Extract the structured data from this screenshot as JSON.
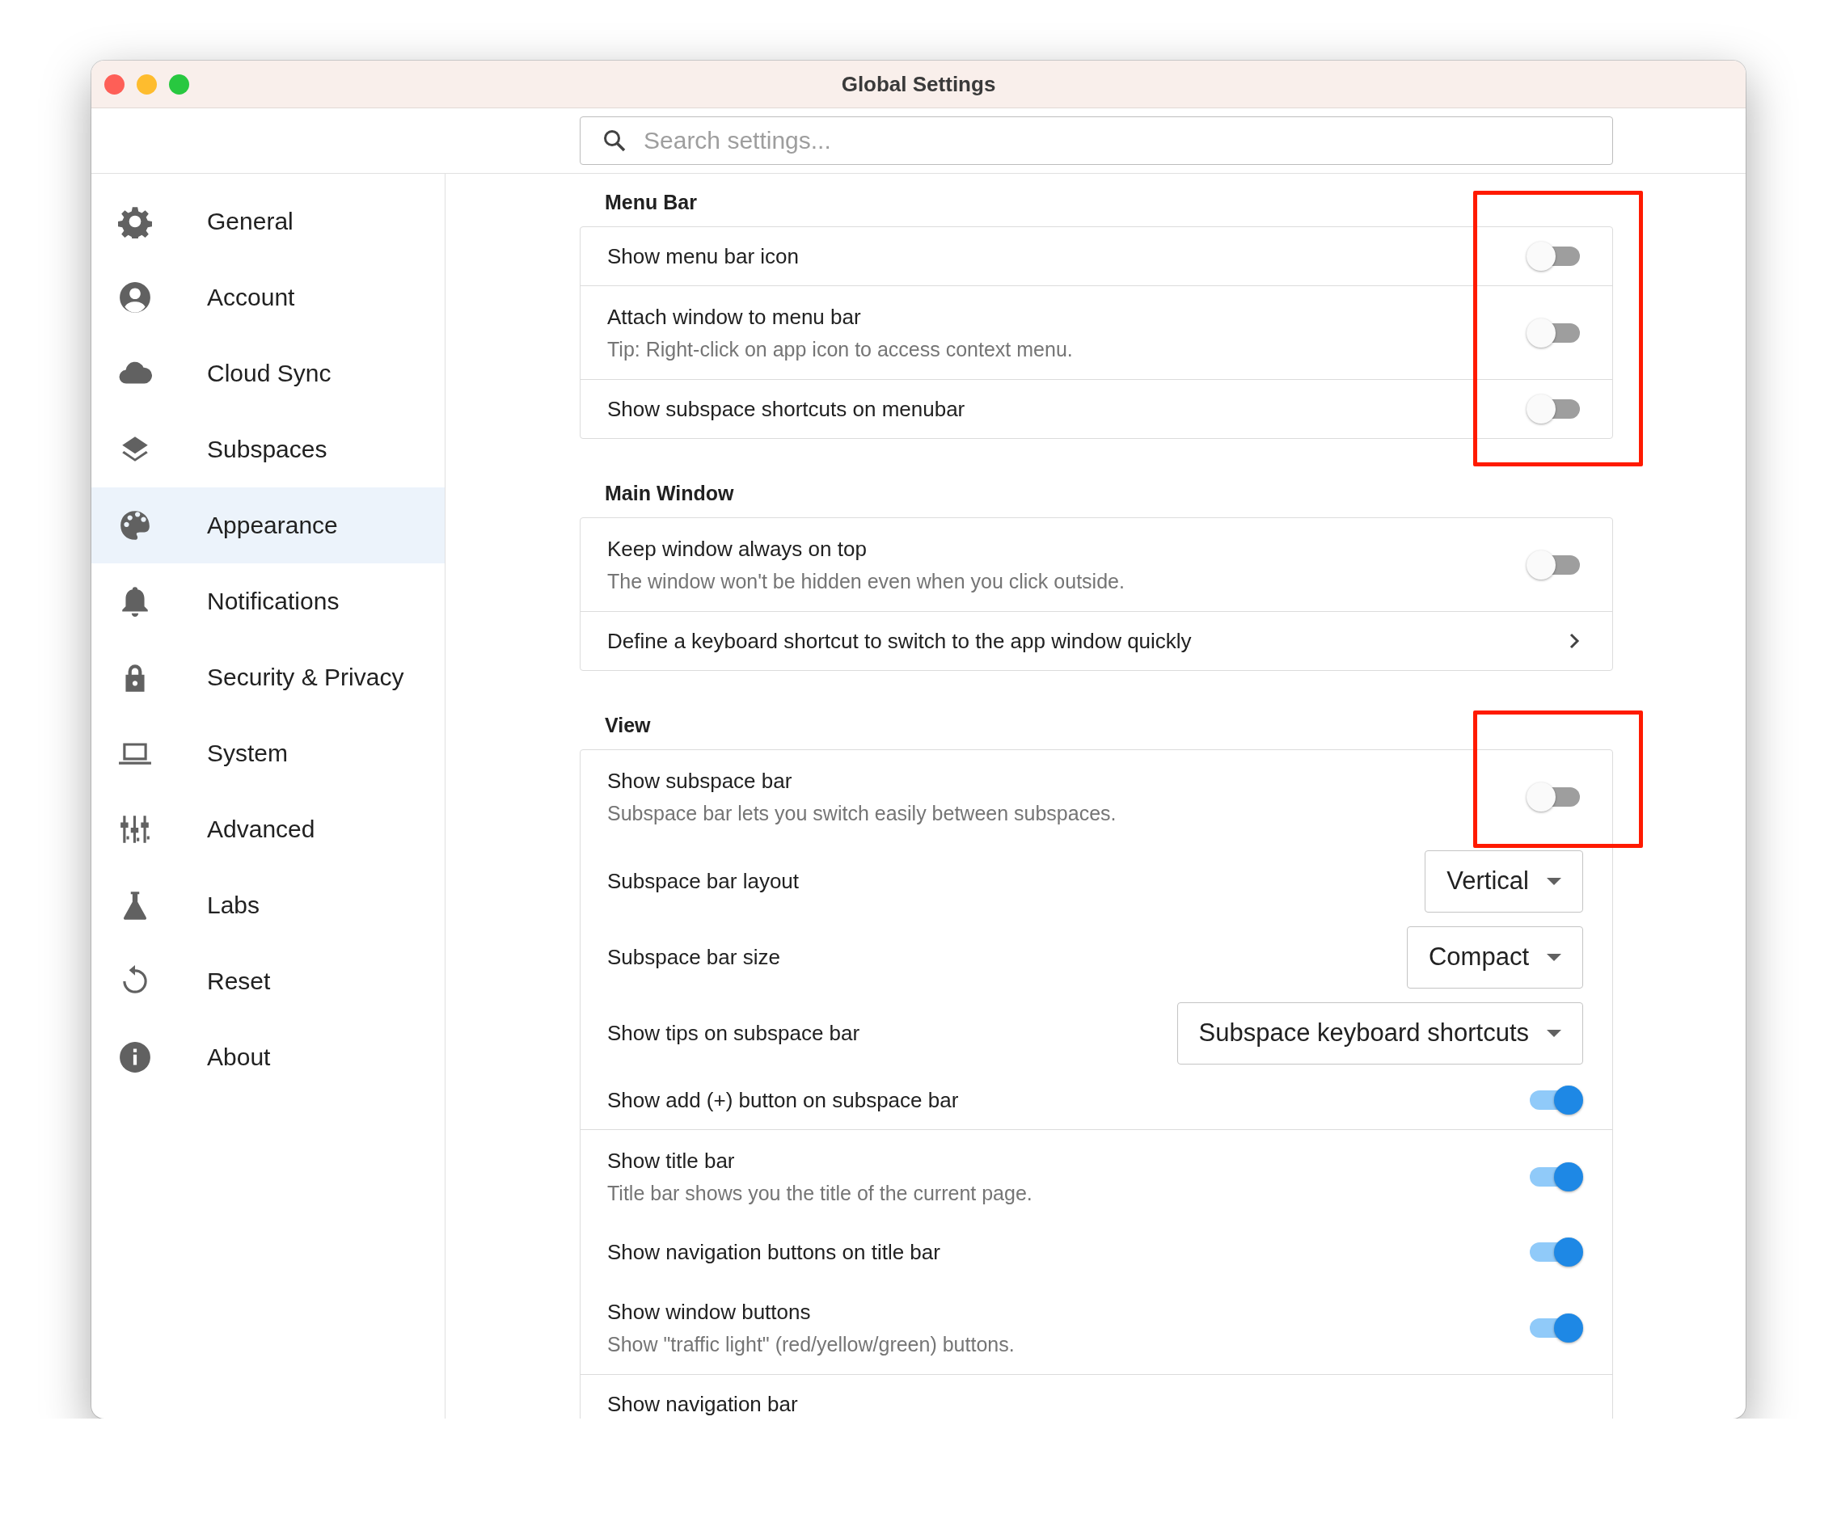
{
  "window": {
    "title": "Global Settings"
  },
  "search": {
    "placeholder": "Search settings..."
  },
  "sidebar": {
    "items": [
      {
        "label": "General",
        "selected": false
      },
      {
        "label": "Account",
        "selected": false
      },
      {
        "label": "Cloud Sync",
        "selected": false
      },
      {
        "label": "Subspaces",
        "selected": false
      },
      {
        "label": "Appearance",
        "selected": true
      },
      {
        "label": "Notifications",
        "selected": false
      },
      {
        "label": "Security & Privacy",
        "selected": false
      },
      {
        "label": "System",
        "selected": false
      },
      {
        "label": "Advanced",
        "selected": false
      },
      {
        "label": "Labs",
        "selected": false
      },
      {
        "label": "Reset",
        "selected": false
      },
      {
        "label": "About",
        "selected": false
      }
    ]
  },
  "sections": [
    {
      "title": "Menu Bar",
      "groups": [
        [
          {
            "kind": "toggle",
            "label": "Show menu bar icon",
            "on": false,
            "annotated": true
          }
        ],
        [
          {
            "kind": "toggle",
            "label": "Attach window to menu bar",
            "description": "Tip: Right-click on app icon to access context menu.",
            "on": false,
            "annotated": true
          }
        ],
        [
          {
            "kind": "toggle",
            "label": "Show subspace shortcuts on menubar",
            "on": false,
            "annotated": true
          }
        ]
      ]
    },
    {
      "title": "Main Window",
      "groups": [
        [
          {
            "kind": "toggle",
            "label": "Keep window always on top",
            "description": "The window won't be hidden even when you click outside.",
            "on": false,
            "annotated": false
          }
        ],
        [
          {
            "kind": "link",
            "label": "Define a keyboard shortcut to switch to the app window quickly"
          }
        ]
      ]
    },
    {
      "title": "View",
      "groups": [
        [
          {
            "kind": "toggle",
            "label": "Show subspace bar",
            "description": "Subspace bar lets you switch easily between subspaces.",
            "on": false,
            "annotated": true
          },
          {
            "kind": "dropdown",
            "label": "Subspace bar layout",
            "value": "Vertical"
          },
          {
            "kind": "dropdown",
            "label": "Subspace bar size",
            "value": "Compact"
          },
          {
            "kind": "dropdown",
            "label": "Show tips on subspace bar",
            "value": "Subspace keyboard shortcuts"
          },
          {
            "kind": "toggle",
            "label": "Show add (+) button on subspace bar",
            "on": true,
            "annotated": false
          }
        ],
        [
          {
            "kind": "toggle",
            "label": "Show title bar",
            "description": "Title bar shows you the title of the current page.",
            "on": true,
            "annotated": false
          },
          {
            "kind": "toggle",
            "label": "Show navigation buttons on title bar",
            "on": true,
            "annotated": false
          },
          {
            "kind": "toggle",
            "label": "Show window buttons",
            "description": "Show \"traffic light\" (red/yellow/green) buttons.",
            "on": true,
            "annotated": false
          }
        ],
        [
          {
            "kind": "label",
            "label": "Show navigation bar"
          }
        ]
      ]
    }
  ]
}
